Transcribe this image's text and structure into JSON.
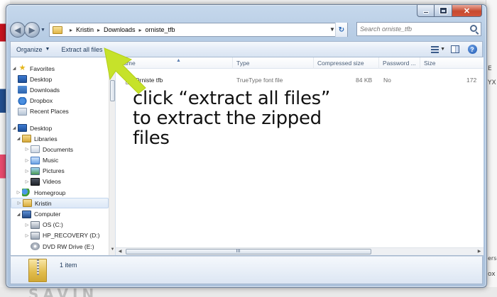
{
  "window": {
    "caption": {
      "minimize": "–",
      "maximize": "□",
      "close": "✕"
    }
  },
  "nav": {
    "breadcrumbs": [
      "Kristin",
      "Downloads",
      "orniste_tfb"
    ],
    "search_placeholder": "Search orniste_tfb"
  },
  "commandbar": {
    "organize": "Organize",
    "extract": "Extract all files"
  },
  "sidebar": {
    "favorites": {
      "label": "Favorites",
      "items": [
        "Desktop",
        "Downloads",
        "Dropbox",
        "Recent Places"
      ]
    },
    "desktop": "Desktop",
    "libraries": {
      "label": "Libraries",
      "items": [
        "Documents",
        "Music",
        "Pictures",
        "Videos"
      ]
    },
    "homegroup": "Homegroup",
    "user": "Kristin",
    "computer": {
      "label": "Computer",
      "drives": [
        "OS (C:)",
        "HP_RECOVERY (D:)",
        "DVD RW Drive (E:)"
      ]
    }
  },
  "table": {
    "columns": [
      "Name",
      "Type",
      "Compressed size",
      "Password ...",
      "Size"
    ],
    "rows": [
      {
        "name": "Orniste tfb",
        "type": "TrueType font file",
        "compressed": "84 KB",
        "password": "No",
        "size": "172"
      }
    ]
  },
  "details": {
    "count": "1 item"
  },
  "annotation": {
    "text": "click “extract all files”\nto extract the zipped\nfiles"
  },
  "background": {
    "right_fragments": [
      "E",
      "YX",
      "ersor",
      "ox"
    ],
    "bottom_text": "SAVIN"
  },
  "colors": {
    "arrow": "#c6e22a",
    "accent": "#1e395b"
  }
}
